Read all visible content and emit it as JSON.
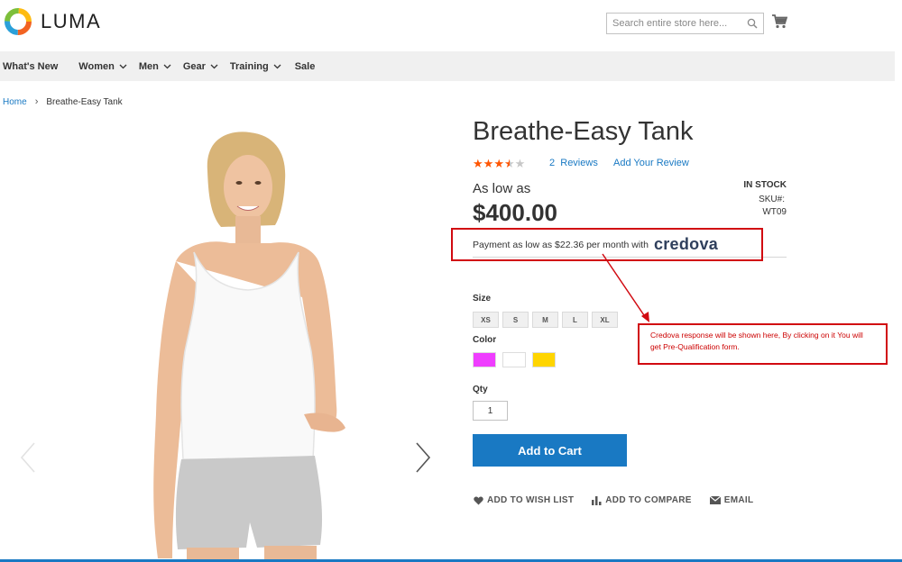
{
  "header": {
    "logo_text": "LUMA",
    "search_placeholder": "Search entire store here...",
    "cart_icon": "cart-icon"
  },
  "nav": {
    "items": [
      {
        "label": "What's New",
        "has_dropdown": false
      },
      {
        "label": "Women",
        "has_dropdown": true
      },
      {
        "label": "Men",
        "has_dropdown": true
      },
      {
        "label": "Gear",
        "has_dropdown": true
      },
      {
        "label": "Training",
        "has_dropdown": true
      },
      {
        "label": "Sale",
        "has_dropdown": false
      }
    ]
  },
  "breadcrumb": {
    "home": "Home",
    "current": "Breathe-Easy Tank"
  },
  "product": {
    "title": "Breathe-Easy Tank",
    "rating_stars": 3.5,
    "reviews_count": "2",
    "reviews_label": "Reviews",
    "add_review_label": "Add Your Review",
    "as_low_as_label": "As low as",
    "price": "$400.00",
    "stock_status": "IN STOCK",
    "sku_label": "SKU#:",
    "sku_value": "WT09",
    "payment_text": "Payment as low as $22.36 per month with",
    "payment_brand": "credova",
    "size_label": "Size",
    "sizes": [
      "XS",
      "S",
      "M",
      "L",
      "XL"
    ],
    "color_label": "Color",
    "colors": [
      "#ef3dff",
      "#ffffff",
      "#ffd500"
    ],
    "qty_label": "Qty",
    "qty_value": "1",
    "add_to_cart_label": "Add to Cart",
    "actions": {
      "wishlist": "ADD TO WISH LIST",
      "compare": "ADD TO COMPARE",
      "email": "EMAIL"
    }
  },
  "annotation": {
    "text": "Credova response will be shown here, By clicking on it You will get Pre-Qualification form."
  },
  "colors": {
    "accent": "#1979c3",
    "annotation_red": "#d10a11",
    "star_filled": "#ff5501",
    "star_empty": "#c7c7c7"
  }
}
